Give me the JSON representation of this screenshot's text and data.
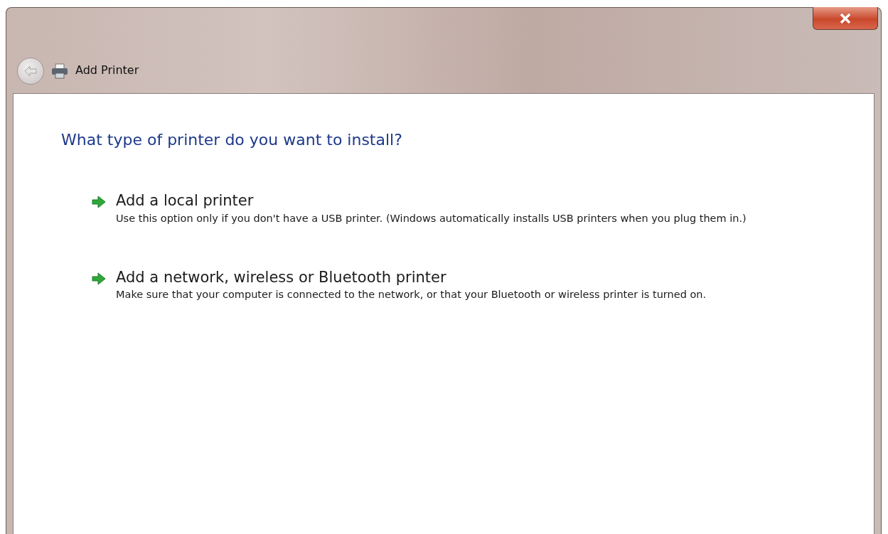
{
  "window": {
    "title": "Add Printer"
  },
  "heading": "What type of printer do you want to install?",
  "options": [
    {
      "title": "Add a local printer",
      "description": "Use this option only if you don't have a USB printer. (Windows automatically installs USB printers when you plug them in.)"
    },
    {
      "title": "Add a network, wireless or Bluetooth printer",
      "description": "Make sure that your computer is connected to the network, or that your Bluetooth or wireless printer is turned on."
    }
  ]
}
